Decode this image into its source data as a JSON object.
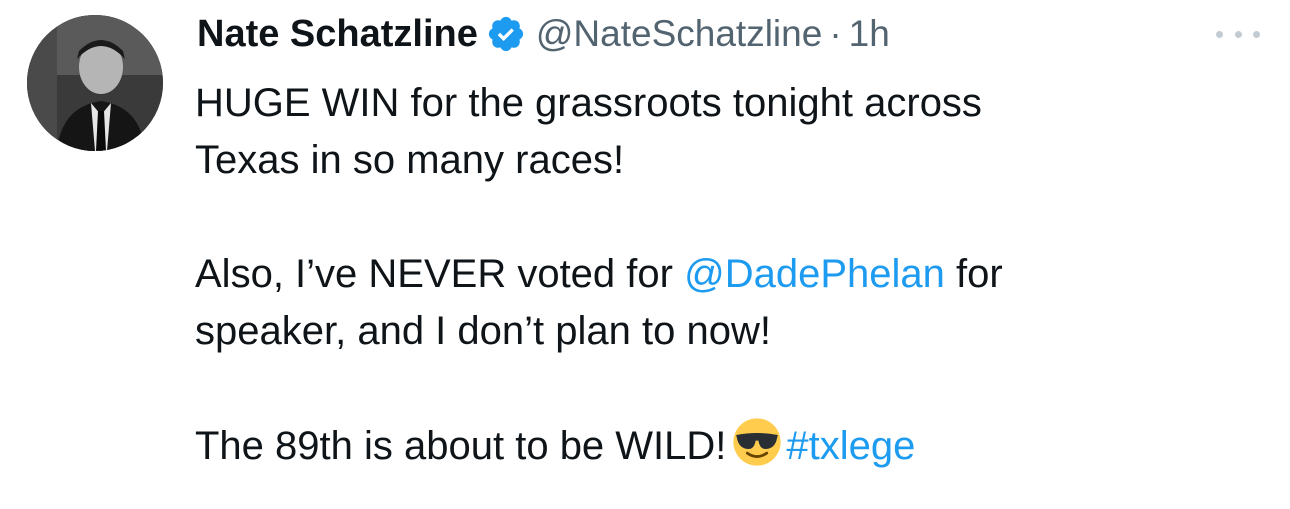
{
  "tweet": {
    "author": {
      "display_name": "Nate Schatzline",
      "handle": "@NateSchatzline",
      "verified": true,
      "avatar_icon": "profile-photo"
    },
    "separator": "·",
    "time": "1h",
    "more_icon": "more-horizontal-icon",
    "text": {
      "line1": "HUGE WIN for the grassroots tonight across",
      "line2": "Texas in so many races!",
      "line3_before": "Also, I’ve NEVER voted for ",
      "line3_mention": "@DadePhelan",
      "line3_after": " for",
      "line4": "speaker, and I don’t plan to now!",
      "line5_before": "The 89th is about to be WILD!",
      "emoji": "😎",
      "hashtag": "#txlege"
    }
  },
  "colors": {
    "text": "#0f1419",
    "secondary": "#536471",
    "link": "#1d9bf0",
    "verified": "#1d9bf0"
  }
}
